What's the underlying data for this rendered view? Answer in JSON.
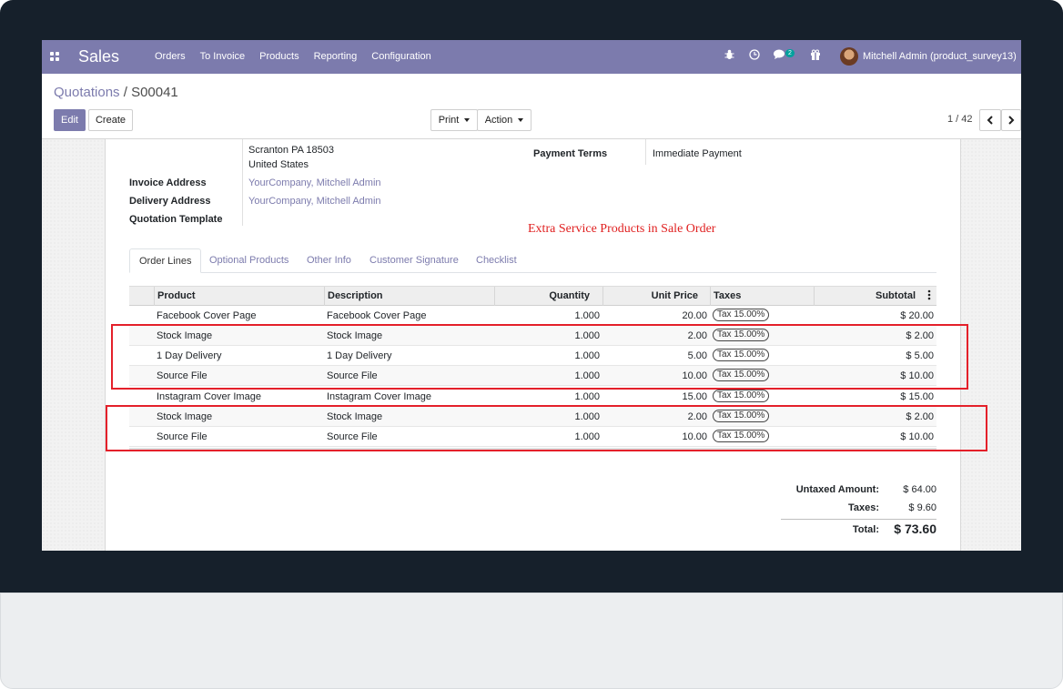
{
  "navbar": {
    "brand": "Sales",
    "menu": [
      "Orders",
      "To Invoice",
      "Products",
      "Reporting",
      "Configuration"
    ],
    "chat_count": "2",
    "user": "Mitchell Admin (product_survey13)"
  },
  "breadcrumb": {
    "parent": "Quotations",
    "separator": " / ",
    "current": "S00041"
  },
  "buttons": {
    "edit": "Edit",
    "create": "Create",
    "print": "Print",
    "action": "Action"
  },
  "pager": {
    "value": "1 / 42"
  },
  "form": {
    "address_line1": "Scranton PA 18503",
    "address_line2": "United States",
    "invoice_address_label": "Invoice Address",
    "invoice_address_value": "YourCompany, Mitchell Admin",
    "delivery_address_label": "Delivery Address",
    "delivery_address_value": "YourCompany, Mitchell Admin",
    "quotation_template_label": "Quotation Template",
    "payment_terms_label": "Payment Terms",
    "payment_terms_value": "Immediate Payment"
  },
  "annotation": "Extra Service Products in Sale Order",
  "tabs": [
    "Order Lines",
    "Optional Products",
    "Other Info",
    "Customer Signature",
    "Checklist"
  ],
  "table": {
    "headers": {
      "product": "Product",
      "description": "Description",
      "quantity": "Quantity",
      "unit_price": "Unit Price",
      "taxes": "Taxes",
      "subtotal": "Subtotal"
    },
    "rows": [
      {
        "product": "Facebook Cover Page",
        "description": "Facebook Cover Page",
        "quantity": "1.000",
        "unit_price": "20.00",
        "tax": "Tax 15.00%",
        "subtotal": "$ 20.00"
      },
      {
        "product": "Stock Image",
        "description": "Stock Image",
        "quantity": "1.000",
        "unit_price": "2.00",
        "tax": "Tax 15.00%",
        "subtotal": "$ 2.00"
      },
      {
        "product": "1 Day Delivery",
        "description": "1 Day Delivery",
        "quantity": "1.000",
        "unit_price": "5.00",
        "tax": "Tax 15.00%",
        "subtotal": "$ 5.00"
      },
      {
        "product": "Source File",
        "description": "Source File",
        "quantity": "1.000",
        "unit_price": "10.00",
        "tax": "Tax 15.00%",
        "subtotal": "$ 10.00"
      },
      {
        "product": "Instagram Cover Image",
        "description": "Instagram Cover Image",
        "quantity": "1.000",
        "unit_price": "15.00",
        "tax": "Tax 15.00%",
        "subtotal": "$ 15.00"
      },
      {
        "product": "Stock Image",
        "description": "Stock Image",
        "quantity": "1.000",
        "unit_price": "2.00",
        "tax": "Tax 15.00%",
        "subtotal": "$ 2.00"
      },
      {
        "product": "Source File",
        "description": "Source File",
        "quantity": "1.000",
        "unit_price": "10.00",
        "tax": "Tax 15.00%",
        "subtotal": "$ 10.00"
      }
    ]
  },
  "totals": {
    "untaxed_label": "Untaxed Amount:",
    "untaxed_value": "$ 64.00",
    "taxes_label": "Taxes:",
    "taxes_value": "$ 9.60",
    "total_label": "Total:",
    "total_value": "$ 73.60"
  },
  "colors": {
    "brand": "#7c7bad",
    "highlight": "#e4202a",
    "bezel": "#16202b"
  }
}
